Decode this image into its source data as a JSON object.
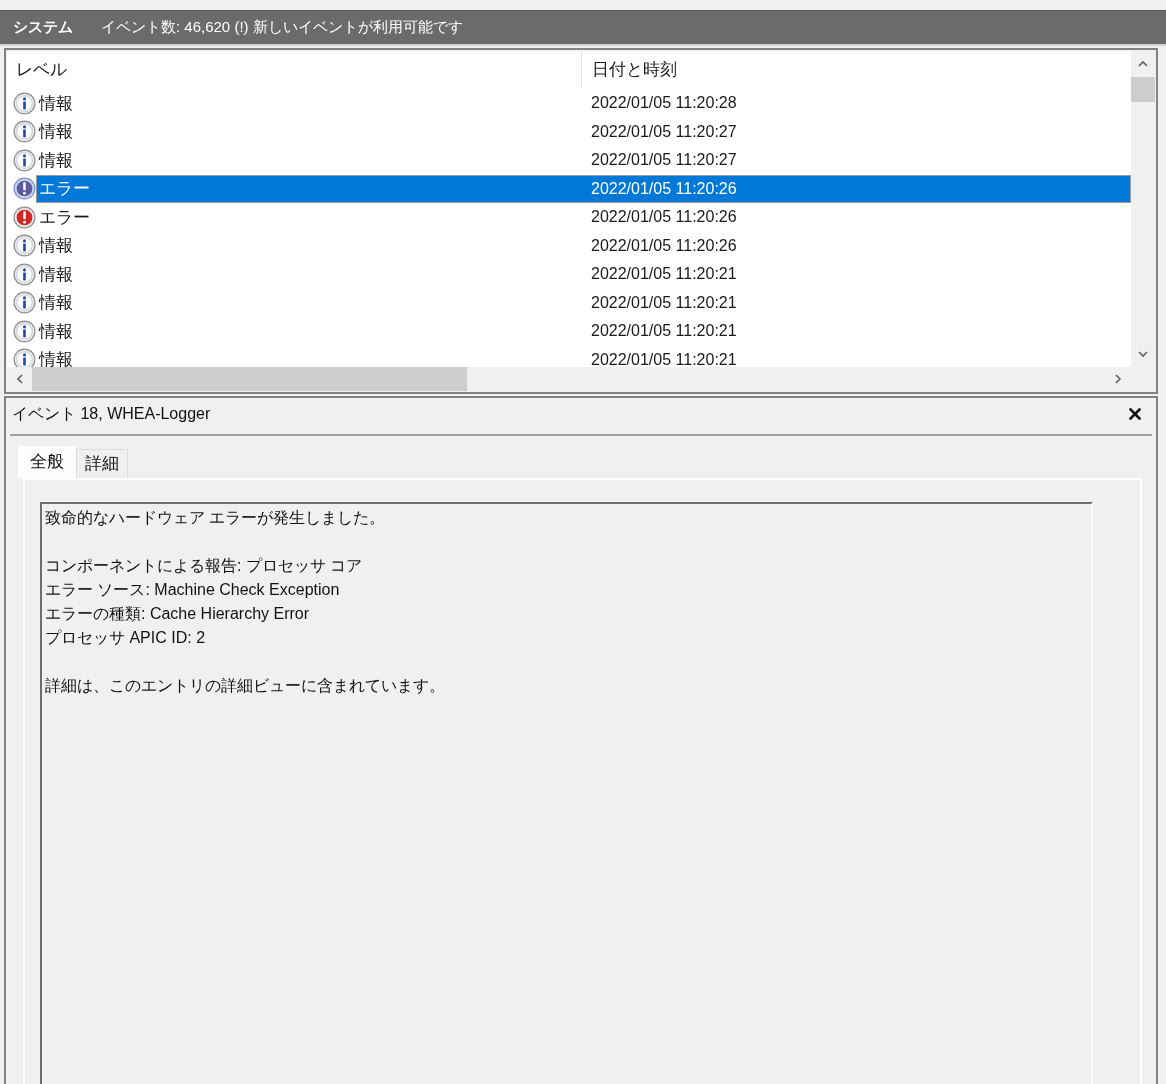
{
  "header": {
    "title": "システム",
    "summary": "イベント数: 46,620 (!) 新しいイベントが利用可能です"
  },
  "event_list": {
    "columns": [
      "レベル",
      "日付と時刻"
    ],
    "rows": [
      {
        "kind": "info",
        "severity": "情報",
        "datetime": "2022/01/05 11:20:28",
        "selected": false
      },
      {
        "kind": "info",
        "severity": "情報",
        "datetime": "2022/01/05 11:20:27",
        "selected": false
      },
      {
        "kind": "info",
        "severity": "情報",
        "datetime": "2022/01/05 11:20:27",
        "selected": false
      },
      {
        "kind": "error",
        "severity": "エラー",
        "datetime": "2022/01/05 11:20:26",
        "selected": true
      },
      {
        "kind": "error",
        "severity": "エラー",
        "datetime": "2022/01/05 11:20:26",
        "selected": false
      },
      {
        "kind": "info",
        "severity": "情報",
        "datetime": "2022/01/05 11:20:26",
        "selected": false
      },
      {
        "kind": "info",
        "severity": "情報",
        "datetime": "2022/01/05 11:20:21",
        "selected": false
      },
      {
        "kind": "info",
        "severity": "情報",
        "datetime": "2022/01/05 11:20:21",
        "selected": false
      },
      {
        "kind": "info",
        "severity": "情報",
        "datetime": "2022/01/05 11:20:21",
        "selected": false
      },
      {
        "kind": "info",
        "severity": "情報",
        "datetime": "2022/01/05 11:20:21",
        "selected": false
      }
    ]
  },
  "detail": {
    "title": "イベント 18, WHEA-Logger",
    "tabs": [
      {
        "label": "全般",
        "selected": true
      },
      {
        "label": "詳細",
        "selected": false
      }
    ],
    "message": [
      [
        "致命的なハードウェア エラーが発生しました。"
      ],
      [
        "コンポーネントによる報告: プロセッサ コア",
        "エラー ソース: Machine Check Exception",
        "エラーの種類: Cache Hierarchy Error",
        "プロセッサ APIC ID: 2"
      ],
      [
        "詳細は、このエントリの詳細ビューに含まれています。"
      ]
    ]
  }
}
